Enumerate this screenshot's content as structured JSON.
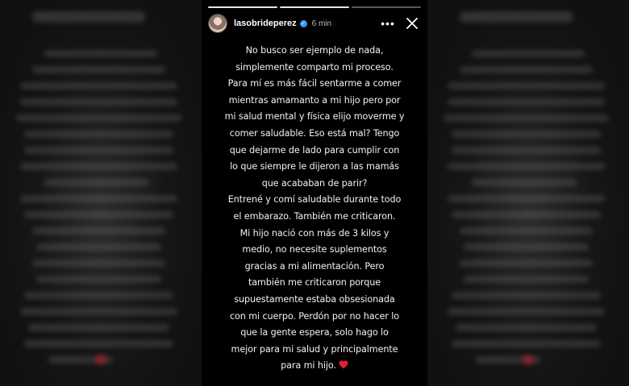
{
  "story": {
    "username": "lasobrideperez",
    "time": "6 min",
    "more_label": "•••",
    "close_label": "close",
    "progress_segments": 3,
    "progress_done": 2,
    "verified_mark": "✓",
    "lines": [
      "No busco ser ejemplo de nada,",
      "simplemente comparto mi proceso.",
      "Para mí es más fácil sentarme a comer",
      "mientras amamanto a mi hijo pero por",
      "mi salud mental y física elijo moverme y",
      "comer saludable. Eso está mal? Tengo",
      "que dejarme de lado para cumplir con",
      "lo que siempre le dijeron a las mamás",
      "que acababan de parir?",
      "Entrené y comí saludable durante todo",
      "el embarazo. También me criticaron.",
      "Mi hijo nació con más de 3 kilos y",
      "medio, no necesite suplementos",
      "gracias a mi alimentación. Pero",
      "también me criticaron porque",
      "supuestamente estaba obsesionada",
      "con mi cuerpo. Perdón por no hacer lo",
      "que la gente espera, solo hago lo",
      "mejor para mi salud y principalmente",
      "para mi hijo."
    ],
    "icons": {
      "verified": "verified-badge-icon",
      "close": "close-icon",
      "heart": "heart-icon",
      "more": "more-options-icon"
    },
    "colors": {
      "background": "#000000",
      "text": "#f2f2f2",
      "heart": "#e0202e",
      "verified": "#3897f0"
    }
  }
}
